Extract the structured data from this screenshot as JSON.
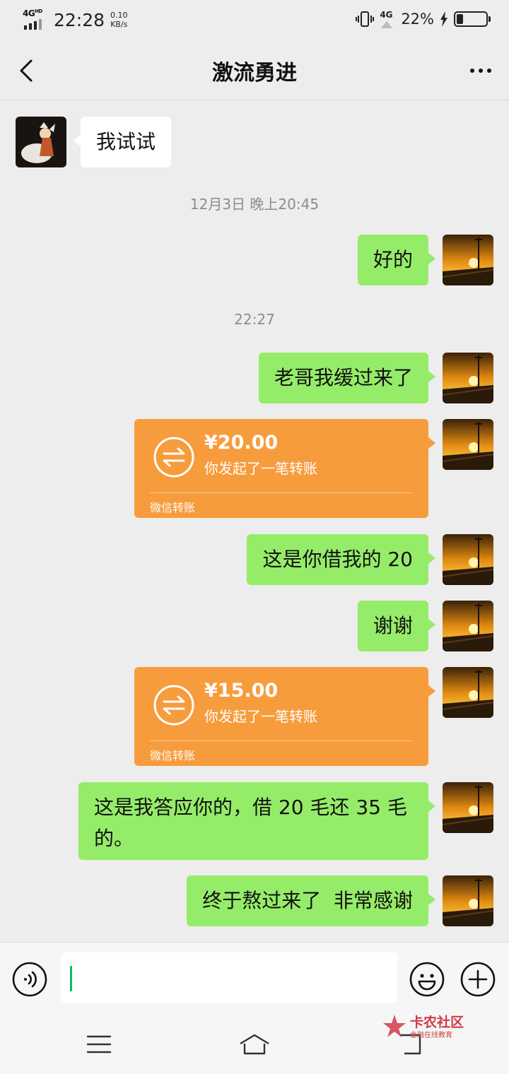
{
  "status_bar": {
    "network": "4G",
    "network_sup": "HD",
    "time": "22:28",
    "speed_value": "0.10",
    "speed_unit": "KB/s",
    "net_right": "4G",
    "battery_percent": "22%",
    "battery_level": 0.22
  },
  "header": {
    "title": "激流勇进",
    "back_icon": "chevron-left-icon",
    "more_icon": "more-dots-icon"
  },
  "messages": [
    {
      "sender": "other",
      "type": "text",
      "text": "我试试"
    },
    {
      "type": "timestamp",
      "text": "12月3日 晚上20:45"
    },
    {
      "sender": "me",
      "type": "text",
      "text": "好的"
    },
    {
      "type": "timestamp",
      "text": "22:27"
    },
    {
      "sender": "me",
      "type": "text",
      "text": "老哥我缓过来了"
    },
    {
      "sender": "me",
      "type": "transfer",
      "amount": "¥20.00",
      "desc": "你发起了一笔转账",
      "footer": "微信转账"
    },
    {
      "sender": "me",
      "type": "text",
      "text": "这是你借我的 20"
    },
    {
      "sender": "me",
      "type": "text",
      "text": "谢谢"
    },
    {
      "sender": "me",
      "type": "transfer",
      "amount": "¥15.00",
      "desc": "你发起了一笔转账",
      "footer": "微信转账"
    },
    {
      "sender": "me",
      "type": "text",
      "text": "这是我答应你的，借 20 毛还 35 毛的。"
    },
    {
      "sender": "me",
      "type": "text",
      "text": "终于熬过来了  非常感谢"
    }
  ],
  "input_bar": {
    "voice_icon": "voice-icon",
    "emoji_icon": "emoji-icon",
    "plus_icon": "plus-icon",
    "text_value": ""
  },
  "watermark": {
    "name": "卡农社区",
    "tagline": "金融在线教育"
  },
  "colors": {
    "me_bubble": "#95ec69",
    "transfer": "#f79c3c",
    "background": "#ededed"
  }
}
